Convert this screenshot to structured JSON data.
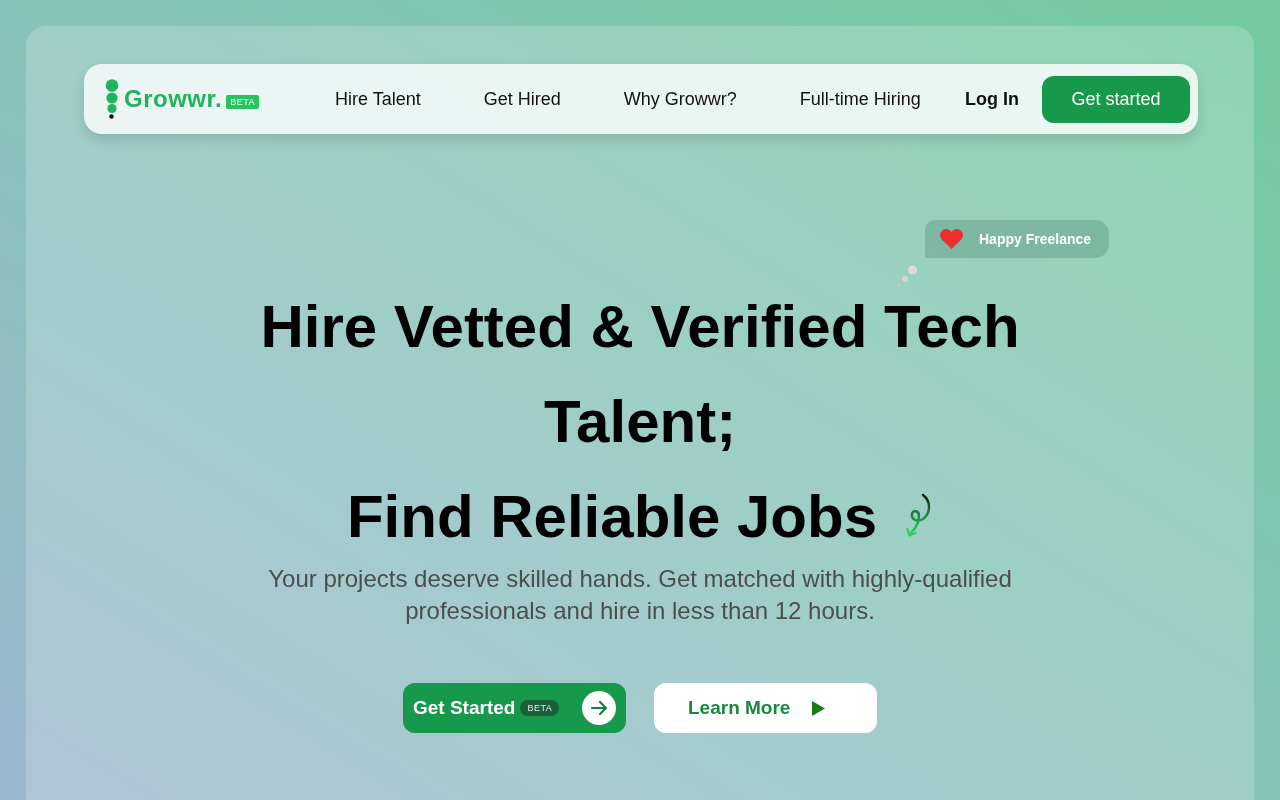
{
  "logo": {
    "name": "Growwr.",
    "badge": "BETA"
  },
  "nav": {
    "links": [
      "Hire Talent",
      "Get Hired",
      "Why Growwr?",
      "Full-time Hiring"
    ],
    "login": "Log In",
    "cta": "Get started"
  },
  "floating_badge": {
    "label": "Happy Freelance"
  },
  "heading": {
    "line_1": "Hire Vetted & Verified Tech Talent;",
    "line_2": "Find Reliable Jobs"
  },
  "subtitle": "Your projects deserve skilled hands. Get matched with highly-qualified professionals and hire in less than 12 hours.",
  "buttons": [
    {
      "kind": "primary",
      "label": "Get Started",
      "badge": "BETA"
    },
    {
      "kind": "secondary",
      "label": "Learn More"
    }
  ]
}
